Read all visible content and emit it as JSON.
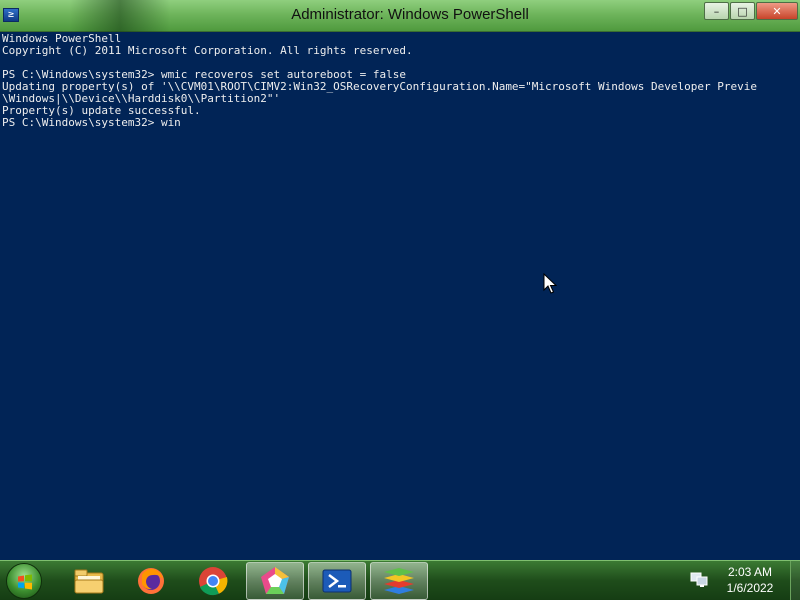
{
  "window": {
    "title": "Administrator: Windows PowerShell",
    "minimize_glyph": "–",
    "maximize_glyph": "□",
    "close_glyph": "✕",
    "icon": "powershell-icon",
    "icon_glyph": "≥"
  },
  "console": {
    "background": "#012456",
    "lines": [
      "Windows PowerShell",
      "Copyright (C) 2011 Microsoft Corporation. All rights reserved.",
      "",
      "PS C:\\Windows\\system32> wmic recoveros set autoreboot = false",
      "Updating property(s) of '\\\\CVM01\\ROOT\\CIMV2:Win32_OSRecoveryConfiguration.Name=\"Microsoft Windows Developer Previe",
      "\\Windows|\\\\Device\\\\Harddisk0\\\\Partition2\"'",
      "Property(s) update successful.",
      "PS C:\\Windows\\system32> win"
    ]
  },
  "taskbar": {
    "start": "start-button",
    "items": [
      "file-explorer",
      "firefox",
      "chrome",
      "app-pentagon",
      "powershell",
      "bluestacks"
    ],
    "clock": {
      "time": "2:03 AM",
      "date": "1/6/2022"
    }
  },
  "colors": {
    "titlebar": "#6fb55c",
    "taskbar": "#1f4d1b",
    "console_text": "#eeeeee"
  }
}
